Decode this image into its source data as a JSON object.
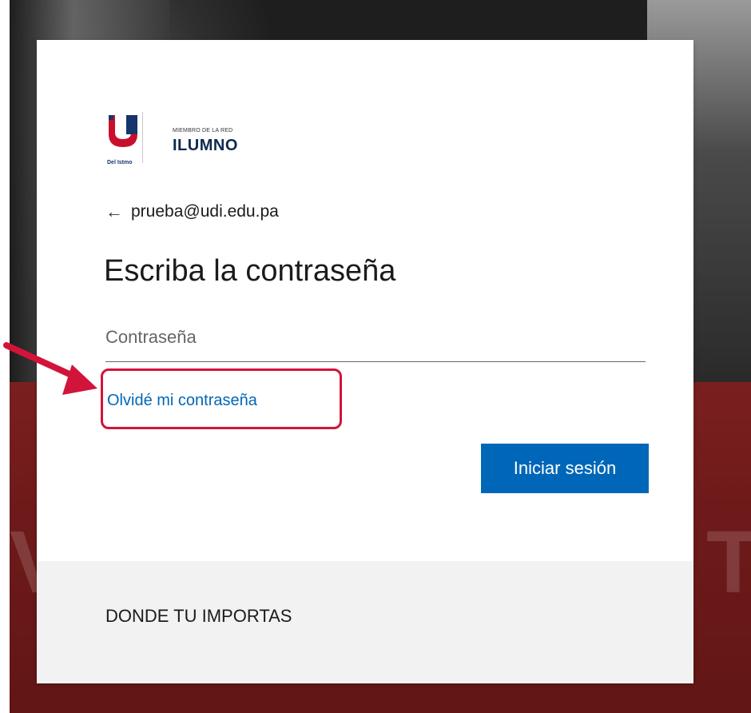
{
  "logo": {
    "pre_title": "MIEMBRO DE LA RED",
    "brand": "ILUMNO",
    "tagline": "Del Istmo"
  },
  "account": {
    "email": "prueba@udi.edu.pa"
  },
  "form": {
    "title": "Escriba la contraseña",
    "password_placeholder": "Contraseña",
    "forgot_link": "Olvidé mi contraseña",
    "signin_button": "Iniciar sesión"
  },
  "footer": {
    "text": "DONDE TU IMPORTAS"
  },
  "colors": {
    "accent": "#0067b8",
    "highlight": "#d2143a",
    "background_red": "#6e1a1a"
  },
  "icons": {
    "back": "back-arrow-icon",
    "annotation": "annotation-arrow-icon"
  }
}
